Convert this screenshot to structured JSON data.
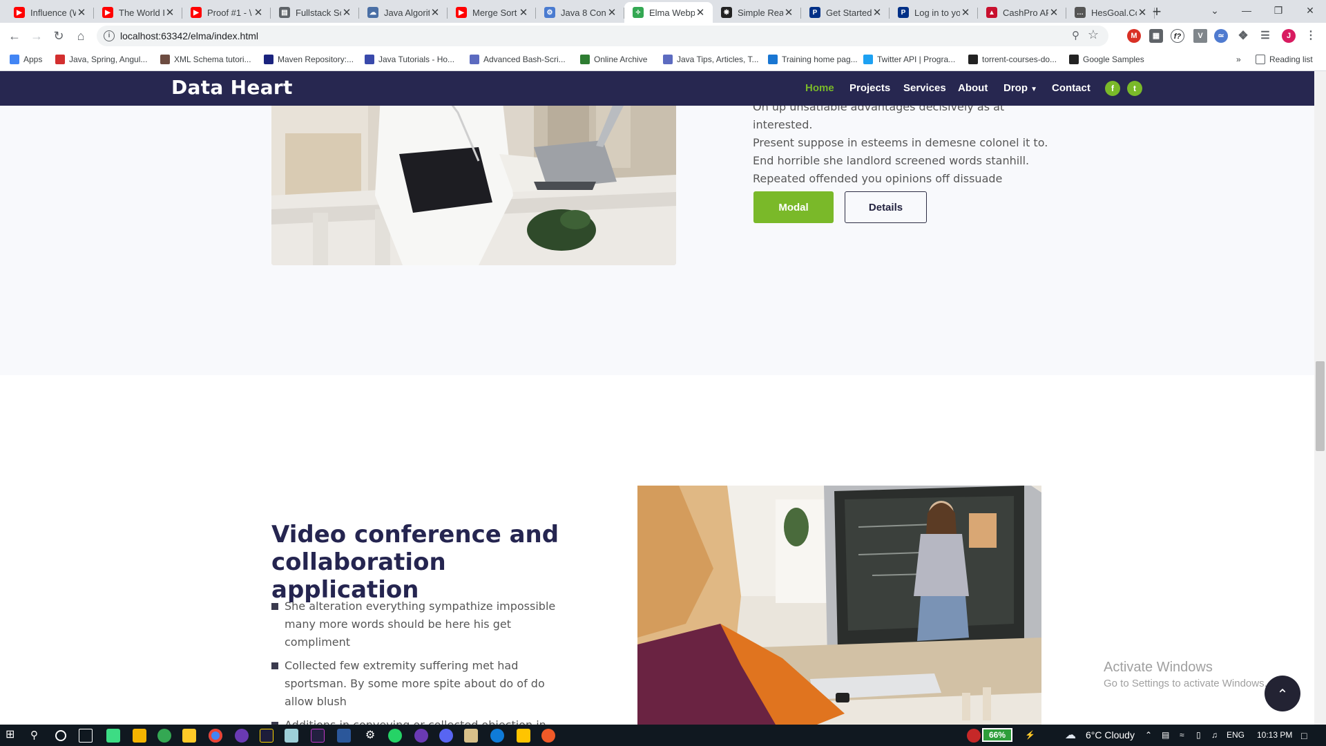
{
  "browser": {
    "tabs": [
      {
        "title": "Influence (W",
        "icon": "youtube-icon",
        "color": "#ff0000",
        "active": false
      },
      {
        "title": "The World I",
        "icon": "youtube-icon",
        "color": "#ff0000",
        "active": false
      },
      {
        "title": "Proof #1 - \\",
        "icon": "youtube-icon",
        "color": "#ff0000",
        "active": false
      },
      {
        "title": "Fullstack Sc",
        "icon": "document-icon",
        "color": "#5f6368",
        "active": false
      },
      {
        "title": "Java Algorit",
        "icon": "cloud-icon",
        "color": "#4a6fa5",
        "active": false
      },
      {
        "title": "Merge Sort",
        "icon": "youtube-icon",
        "color": "#ff0000",
        "active": false
      },
      {
        "title": "Java 8 Conc",
        "icon": "gear-icon",
        "color": "#4a7bd0",
        "active": false
      },
      {
        "title": "Elma Webp",
        "icon": "share-icon",
        "color": "#34a853",
        "active": true
      },
      {
        "title": "Simple Rea",
        "icon": "react-icon",
        "color": "#222222",
        "active": false
      },
      {
        "title": "Get Started",
        "icon": "paypal-icon",
        "color": "#003087",
        "active": false
      },
      {
        "title": "Log in to yo",
        "icon": "paypal-icon",
        "color": "#003087",
        "active": false
      },
      {
        "title": "CashPro AP",
        "icon": "bank-icon",
        "color": "#c8102e",
        "active": false
      },
      {
        "title": "HesGoal.Co",
        "icon": "dots-icon",
        "color": "#555555",
        "active": false
      }
    ],
    "url": "localhost:63342/elma/index.html",
    "profile_initial": "J"
  },
  "bookmarks": [
    {
      "label": "Apps",
      "color": "#4285f4"
    },
    {
      "label": "Java, Spring, Angul...",
      "color": "#d32f2f"
    },
    {
      "label": "XML Schema tutori...",
      "color": "#6d4c41"
    },
    {
      "label": "Maven Repository:...",
      "color": "#1a237e"
    },
    {
      "label": "Java Tutorials - Ho...",
      "color": "#3949ab"
    },
    {
      "label": "Advanced Bash-Scri...",
      "color": "#5c6bc0"
    },
    {
      "label": "Online Archive",
      "color": "#2e7d32"
    },
    {
      "label": "Java Tips, Articles, T...",
      "color": "#5c6bc0"
    },
    {
      "label": "Training home pag...",
      "color": "#1976d2"
    },
    {
      "label": "Twitter API | Progra...",
      "color": "#1da1f2"
    },
    {
      "label": "torrent-courses-do...",
      "color": "#222222"
    },
    {
      "label": "Google Samples",
      "color": "#222222"
    }
  ],
  "reading_list": "Reading list",
  "site": {
    "brand": "Data Heart",
    "nav": [
      "Home",
      "Projects",
      "Services",
      "About",
      "Drop",
      "Contact"
    ],
    "social": [
      "f",
      "t"
    ],
    "accent_color": "#7ab929",
    "nav_bg": "#272750",
    "top_text": [
      "Oh up unsatiable advantages decisively as at interested.",
      "Present suppose in esteems in demesne colonel it to.",
      "End horrible she landlord screened words stanhill.",
      "Repeated offended you opinions off dissuade"
    ],
    "btn_modal": "Modal",
    "btn_details": "Details",
    "section_title": "Video conference and collaboration application",
    "features": [
      "She alteration everything sympathize impossible many more words should be here his get compliment",
      "Collected few extremity suffering met had sportsman. By some more spite about do of do allow blush",
      "Additions in conveying or collected objection in. Suffer few desire wonder her object hardly nearer"
    ]
  },
  "watermark": {
    "title": "Activate Windows",
    "subtitle": "Go to Settings to activate Windows."
  },
  "taskbar": {
    "battery": "66%",
    "weather": "6°C  Cloudy",
    "language": "ENG",
    "time": "10:13 PM"
  }
}
